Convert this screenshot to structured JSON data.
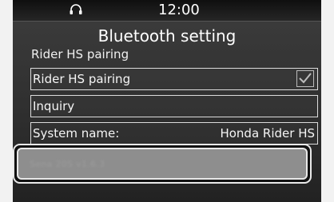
{
  "statusbar": {
    "icon": "headset-icon",
    "time": "12:00"
  },
  "screen": {
    "title": "Bluetooth setting",
    "subtitle": "Rider HS pairing"
  },
  "rows": [
    {
      "label": "Rider HS pairing",
      "checked": true
    },
    {
      "label": "Inquiry"
    },
    {
      "label": "System name:",
      "value": "Honda Rider HS"
    }
  ],
  "selected_item": {
    "label": "Sena 20S v1.6.3"
  },
  "colors": {
    "screen_bg": "#2f2f2f",
    "statusbar_bg": "#0f0f0f",
    "text": "#f2f2f2",
    "border": "#dcdcdc"
  }
}
